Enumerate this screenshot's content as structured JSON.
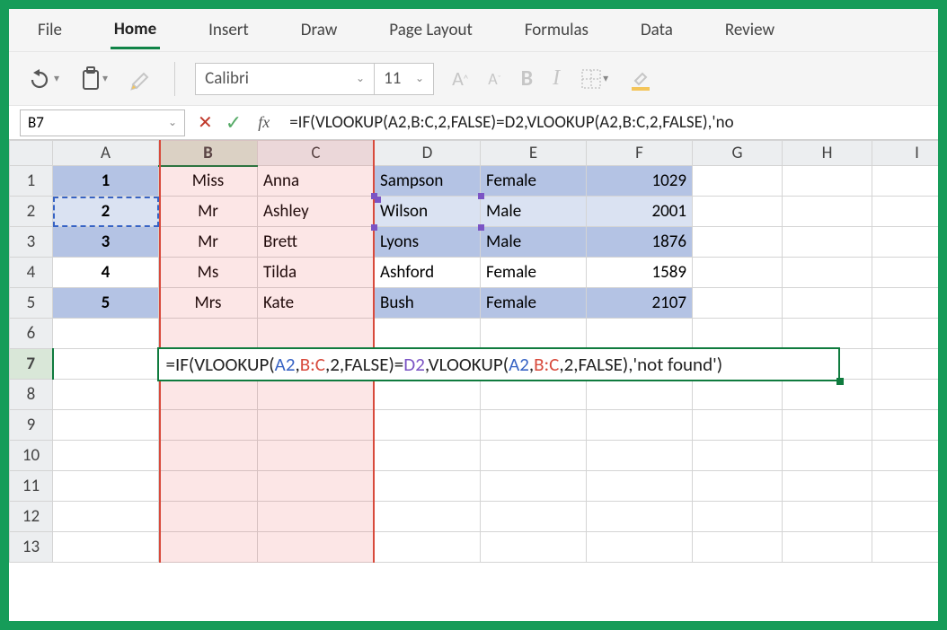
{
  "app": {
    "title": "Excel"
  },
  "ribbon": {
    "tabs": [
      "File",
      "Home",
      "Insert",
      "Draw",
      "Page Layout",
      "Formulas",
      "Data",
      "Review"
    ],
    "active": "Home"
  },
  "toolbar": {
    "font_name": "Calibri",
    "font_size": "11",
    "bold": "B",
    "italic": "I"
  },
  "name_box": {
    "value": "B7"
  },
  "formula_bar": {
    "cancel": "✕",
    "confirm": "✓",
    "fx": "fx",
    "value": "=IF(VLOOKUP(A2,B:C,2,FALSE)=D2,VLOOKUP(A2,B:C,2,FALSE),'no"
  },
  "columns": [
    "A",
    "B",
    "C",
    "D",
    "E",
    "F",
    "G",
    "H",
    "I"
  ],
  "row_count": 13,
  "table": {
    "rows": [
      {
        "A": "1",
        "B": "Miss",
        "C": "Anna",
        "D": "Sampson",
        "E": "Female",
        "F": "1029"
      },
      {
        "A": "2",
        "B": "Mr",
        "C": "Ashley",
        "D": "Wilson",
        "E": "Male",
        "F": "2001"
      },
      {
        "A": "3",
        "B": "Mr",
        "C": "Brett",
        "D": "Lyons",
        "E": "Male",
        "F": "1876"
      },
      {
        "A": "4",
        "B": "Ms",
        "C": "Tilda",
        "D": "Ashford",
        "E": "Female",
        "F": "1589"
      },
      {
        "A": "5",
        "B": "Mrs",
        "C": "Kate",
        "D": "Bush",
        "E": "Female",
        "F": "2107"
      }
    ]
  },
  "cell_edit": {
    "address": "B7",
    "display": "=IF(VLOOKUP(A2,B:C,2,FALSE)=D2,VLOOKUP(A2,B:C,2,FALSE),'not found')",
    "tokens": [
      {
        "t": "=IF(VLOOKUP(",
        "c": "#222"
      },
      {
        "t": "A2",
        "c": "#3763c4"
      },
      {
        "t": ",",
        "c": "#222"
      },
      {
        "t": "B:C",
        "c": "#d84a3c"
      },
      {
        "t": ",2,FALSE)=",
        "c": "#222"
      },
      {
        "t": "D2",
        "c": "#7b54c4"
      },
      {
        "t": ",VLOOKUP(",
        "c": "#222"
      },
      {
        "t": "A2",
        "c": "#3763c4"
      },
      {
        "t": ",",
        "c": "#222"
      },
      {
        "t": "B:C",
        "c": "#d84a3c"
      },
      {
        "t": ",2,FALSE),'not found')",
        "c": "#222"
      }
    ]
  }
}
